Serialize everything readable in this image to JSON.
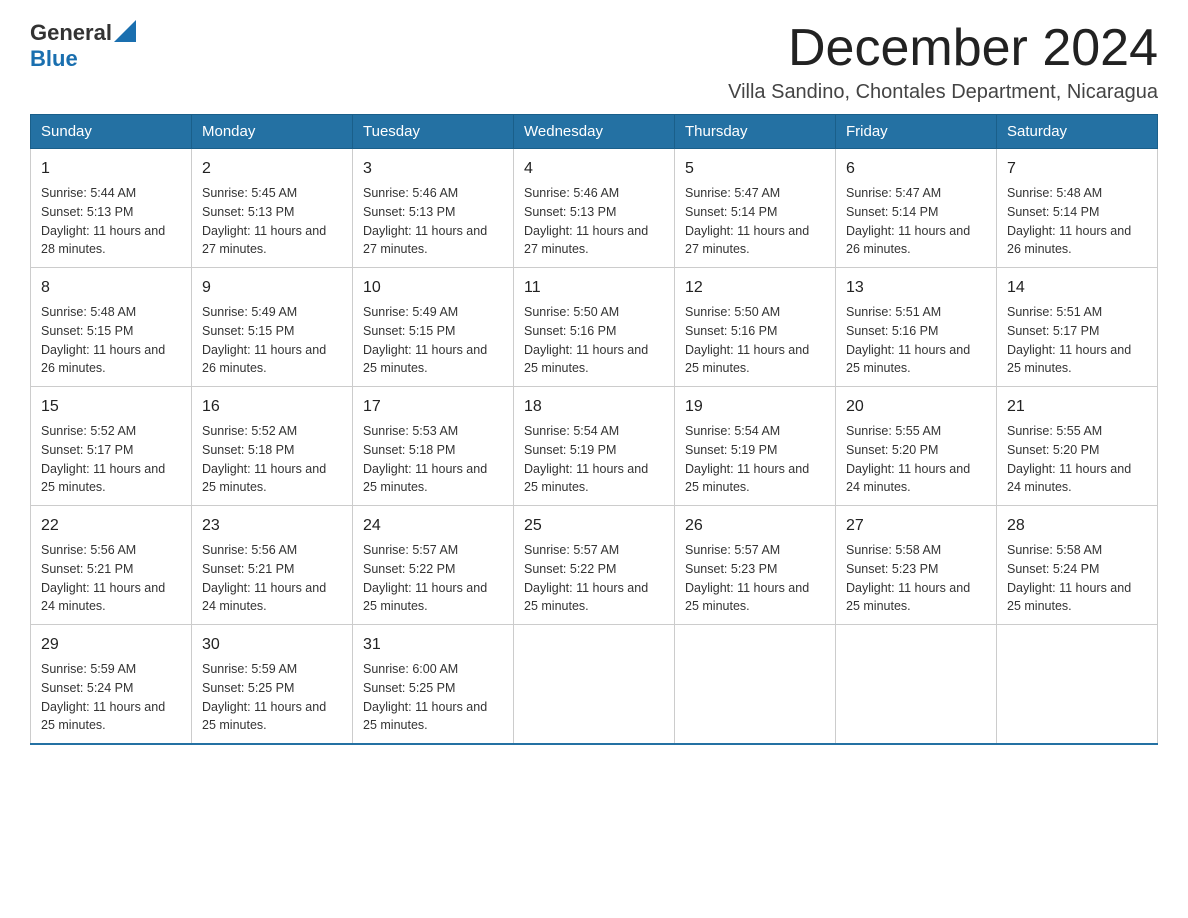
{
  "logo": {
    "general": "General",
    "blue": "Blue"
  },
  "header": {
    "title": "December 2024",
    "location": "Villa Sandino, Chontales Department, Nicaragua"
  },
  "days_of_week": [
    "Sunday",
    "Monday",
    "Tuesday",
    "Wednesday",
    "Thursday",
    "Friday",
    "Saturday"
  ],
  "weeks": [
    [
      {
        "day": "1",
        "sunrise": "Sunrise: 5:44 AM",
        "sunset": "Sunset: 5:13 PM",
        "daylight": "Daylight: 11 hours and 28 minutes."
      },
      {
        "day": "2",
        "sunrise": "Sunrise: 5:45 AM",
        "sunset": "Sunset: 5:13 PM",
        "daylight": "Daylight: 11 hours and 27 minutes."
      },
      {
        "day": "3",
        "sunrise": "Sunrise: 5:46 AM",
        "sunset": "Sunset: 5:13 PM",
        "daylight": "Daylight: 11 hours and 27 minutes."
      },
      {
        "day": "4",
        "sunrise": "Sunrise: 5:46 AM",
        "sunset": "Sunset: 5:13 PM",
        "daylight": "Daylight: 11 hours and 27 minutes."
      },
      {
        "day": "5",
        "sunrise": "Sunrise: 5:47 AM",
        "sunset": "Sunset: 5:14 PM",
        "daylight": "Daylight: 11 hours and 27 minutes."
      },
      {
        "day": "6",
        "sunrise": "Sunrise: 5:47 AM",
        "sunset": "Sunset: 5:14 PM",
        "daylight": "Daylight: 11 hours and 26 minutes."
      },
      {
        "day": "7",
        "sunrise": "Sunrise: 5:48 AM",
        "sunset": "Sunset: 5:14 PM",
        "daylight": "Daylight: 11 hours and 26 minutes."
      }
    ],
    [
      {
        "day": "8",
        "sunrise": "Sunrise: 5:48 AM",
        "sunset": "Sunset: 5:15 PM",
        "daylight": "Daylight: 11 hours and 26 minutes."
      },
      {
        "day": "9",
        "sunrise": "Sunrise: 5:49 AM",
        "sunset": "Sunset: 5:15 PM",
        "daylight": "Daylight: 11 hours and 26 minutes."
      },
      {
        "day": "10",
        "sunrise": "Sunrise: 5:49 AM",
        "sunset": "Sunset: 5:15 PM",
        "daylight": "Daylight: 11 hours and 25 minutes."
      },
      {
        "day": "11",
        "sunrise": "Sunrise: 5:50 AM",
        "sunset": "Sunset: 5:16 PM",
        "daylight": "Daylight: 11 hours and 25 minutes."
      },
      {
        "day": "12",
        "sunrise": "Sunrise: 5:50 AM",
        "sunset": "Sunset: 5:16 PM",
        "daylight": "Daylight: 11 hours and 25 minutes."
      },
      {
        "day": "13",
        "sunrise": "Sunrise: 5:51 AM",
        "sunset": "Sunset: 5:16 PM",
        "daylight": "Daylight: 11 hours and 25 minutes."
      },
      {
        "day": "14",
        "sunrise": "Sunrise: 5:51 AM",
        "sunset": "Sunset: 5:17 PM",
        "daylight": "Daylight: 11 hours and 25 minutes."
      }
    ],
    [
      {
        "day": "15",
        "sunrise": "Sunrise: 5:52 AM",
        "sunset": "Sunset: 5:17 PM",
        "daylight": "Daylight: 11 hours and 25 minutes."
      },
      {
        "day": "16",
        "sunrise": "Sunrise: 5:52 AM",
        "sunset": "Sunset: 5:18 PM",
        "daylight": "Daylight: 11 hours and 25 minutes."
      },
      {
        "day": "17",
        "sunrise": "Sunrise: 5:53 AM",
        "sunset": "Sunset: 5:18 PM",
        "daylight": "Daylight: 11 hours and 25 minutes."
      },
      {
        "day": "18",
        "sunrise": "Sunrise: 5:54 AM",
        "sunset": "Sunset: 5:19 PM",
        "daylight": "Daylight: 11 hours and 25 minutes."
      },
      {
        "day": "19",
        "sunrise": "Sunrise: 5:54 AM",
        "sunset": "Sunset: 5:19 PM",
        "daylight": "Daylight: 11 hours and 25 minutes."
      },
      {
        "day": "20",
        "sunrise": "Sunrise: 5:55 AM",
        "sunset": "Sunset: 5:20 PM",
        "daylight": "Daylight: 11 hours and 24 minutes."
      },
      {
        "day": "21",
        "sunrise": "Sunrise: 5:55 AM",
        "sunset": "Sunset: 5:20 PM",
        "daylight": "Daylight: 11 hours and 24 minutes."
      }
    ],
    [
      {
        "day": "22",
        "sunrise": "Sunrise: 5:56 AM",
        "sunset": "Sunset: 5:21 PM",
        "daylight": "Daylight: 11 hours and 24 minutes."
      },
      {
        "day": "23",
        "sunrise": "Sunrise: 5:56 AM",
        "sunset": "Sunset: 5:21 PM",
        "daylight": "Daylight: 11 hours and 24 minutes."
      },
      {
        "day": "24",
        "sunrise": "Sunrise: 5:57 AM",
        "sunset": "Sunset: 5:22 PM",
        "daylight": "Daylight: 11 hours and 25 minutes."
      },
      {
        "day": "25",
        "sunrise": "Sunrise: 5:57 AM",
        "sunset": "Sunset: 5:22 PM",
        "daylight": "Daylight: 11 hours and 25 minutes."
      },
      {
        "day": "26",
        "sunrise": "Sunrise: 5:57 AM",
        "sunset": "Sunset: 5:23 PM",
        "daylight": "Daylight: 11 hours and 25 minutes."
      },
      {
        "day": "27",
        "sunrise": "Sunrise: 5:58 AM",
        "sunset": "Sunset: 5:23 PM",
        "daylight": "Daylight: 11 hours and 25 minutes."
      },
      {
        "day": "28",
        "sunrise": "Sunrise: 5:58 AM",
        "sunset": "Sunset: 5:24 PM",
        "daylight": "Daylight: 11 hours and 25 minutes."
      }
    ],
    [
      {
        "day": "29",
        "sunrise": "Sunrise: 5:59 AM",
        "sunset": "Sunset: 5:24 PM",
        "daylight": "Daylight: 11 hours and 25 minutes."
      },
      {
        "day": "30",
        "sunrise": "Sunrise: 5:59 AM",
        "sunset": "Sunset: 5:25 PM",
        "daylight": "Daylight: 11 hours and 25 minutes."
      },
      {
        "day": "31",
        "sunrise": "Sunrise: 6:00 AM",
        "sunset": "Sunset: 5:25 PM",
        "daylight": "Daylight: 11 hours and 25 minutes."
      },
      null,
      null,
      null,
      null
    ]
  ]
}
